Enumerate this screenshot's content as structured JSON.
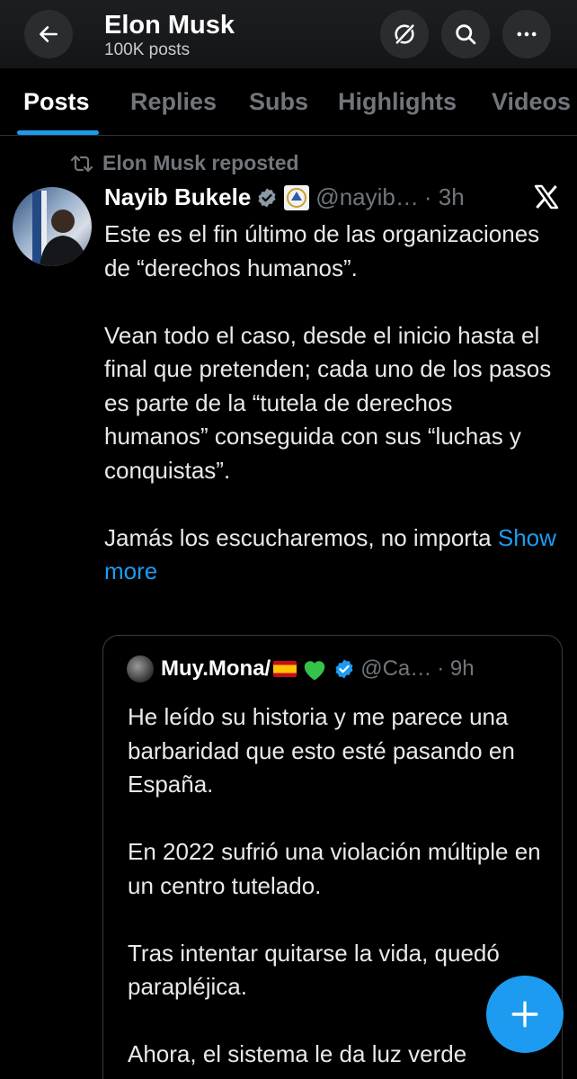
{
  "header": {
    "title": "Elon Musk",
    "subtitle": "100K posts",
    "icons": [
      "back-arrow-icon",
      "grok-icon",
      "search-icon",
      "more-icon"
    ]
  },
  "tabs": [
    {
      "label": "Posts",
      "active": true
    },
    {
      "label": "Replies",
      "active": false
    },
    {
      "label": "Subs",
      "active": false
    },
    {
      "label": "Highlights",
      "active": false
    },
    {
      "label": "Videos",
      "active": false
    }
  ],
  "post": {
    "repost_label": "Elon Musk reposted",
    "author": "Nayib Bukele",
    "handle": "@nayib…",
    "time": "· 3h",
    "paragraphs": [
      "Este es el fin último de las organizaciones de “derechos humanos”.",
      "Vean todo el caso, desde el inicio hasta el final que pretenden; cada uno de los pasos es parte de la “tutela de derechos humanos” conseguida con sus “luchas y conquistas”."
    ],
    "last_paragraph": "Jamás los escucharemos, no importa",
    "show_more": "Show more"
  },
  "quote": {
    "author": "Muy.Mona/",
    "handle": "@Ca…",
    "time": "· 9h",
    "paragraphs": [
      "He leído su historia y me parece una barbaridad que esto esté pasando en España.",
      "En 2022 sufrió una violación múltiple en un centro tutelado.",
      "Tras intentar quitarse la vida, quedó parapléjica.",
      "Ahora, el sistema le da luz verde"
    ]
  },
  "colors": {
    "accent": "#1d9bf0",
    "background": "#000000",
    "muted": "#71767b"
  }
}
